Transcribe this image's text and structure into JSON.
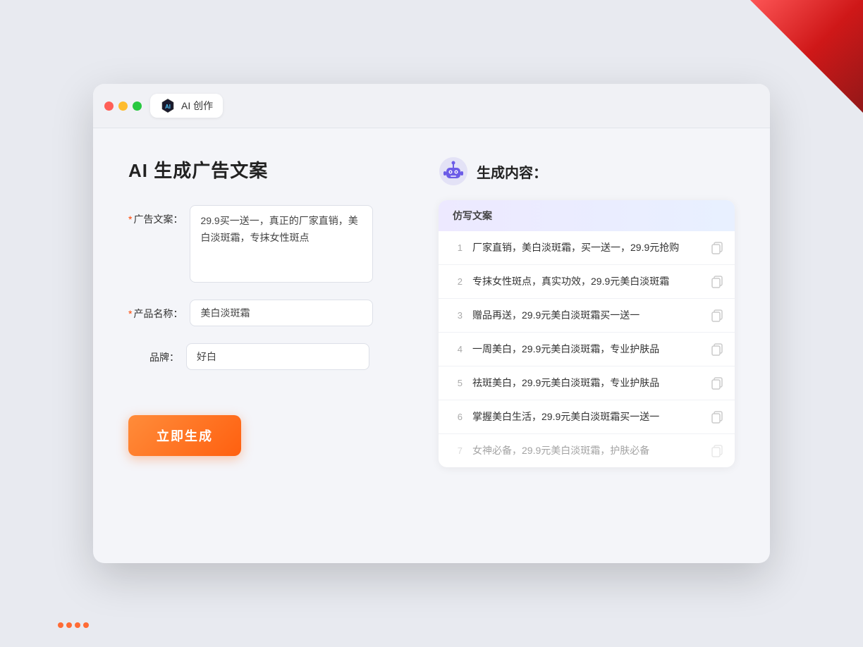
{
  "window": {
    "tab_label": "AI 创作"
  },
  "left": {
    "title": "AI 生成广告文案",
    "ad_label": "广告文案：",
    "ad_required": "*",
    "ad_value": "29.9买一送一，真正的厂家直销，美白淡斑霜，专抹女性斑点",
    "product_label": "产品名称：",
    "product_required": "*",
    "product_value": "美白淡斑霜",
    "brand_label": "品牌：",
    "brand_value": "好白",
    "generate_btn": "立即生成"
  },
  "right": {
    "result_title": "生成内容：",
    "table_header": "仿写文案",
    "rows": [
      {
        "num": "1",
        "text": "厂家直销，美白淡斑霜，买一送一，29.9元抢购",
        "faded": false
      },
      {
        "num": "2",
        "text": "专抹女性斑点，真实功效，29.9元美白淡斑霜",
        "faded": false
      },
      {
        "num": "3",
        "text": "赠品再送，29.9元美白淡斑霜买一送一",
        "faded": false
      },
      {
        "num": "4",
        "text": "一周美白，29.9元美白淡斑霜，专业护肤品",
        "faded": false
      },
      {
        "num": "5",
        "text": "祛斑美白，29.9元美白淡斑霜，专业护肤品",
        "faded": false
      },
      {
        "num": "6",
        "text": "掌握美白生活，29.9元美白淡斑霜买一送一",
        "faded": false
      },
      {
        "num": "7",
        "text": "女神必备，29.9元美白淡斑霜，护肤必备",
        "faded": true
      }
    ]
  }
}
